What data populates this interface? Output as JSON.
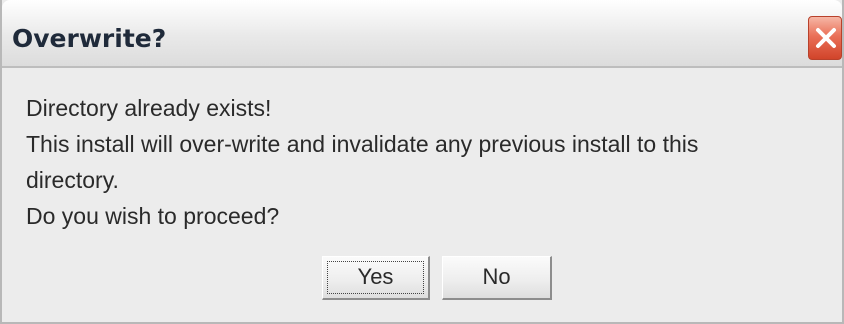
{
  "dialog": {
    "title": "Overwrite?",
    "message_lines": [
      "Directory already exists!",
      "This install will over-write and invalidate any previous install to this",
      "directory.",
      "Do you wish to proceed?"
    ],
    "buttons": {
      "yes_label": "Yes",
      "no_label": "No"
    },
    "close_icon": "close-icon"
  },
  "colors": {
    "close_button": "#e0573c",
    "dialog_background": "#ececec",
    "title_text": "#1f2a3a"
  }
}
